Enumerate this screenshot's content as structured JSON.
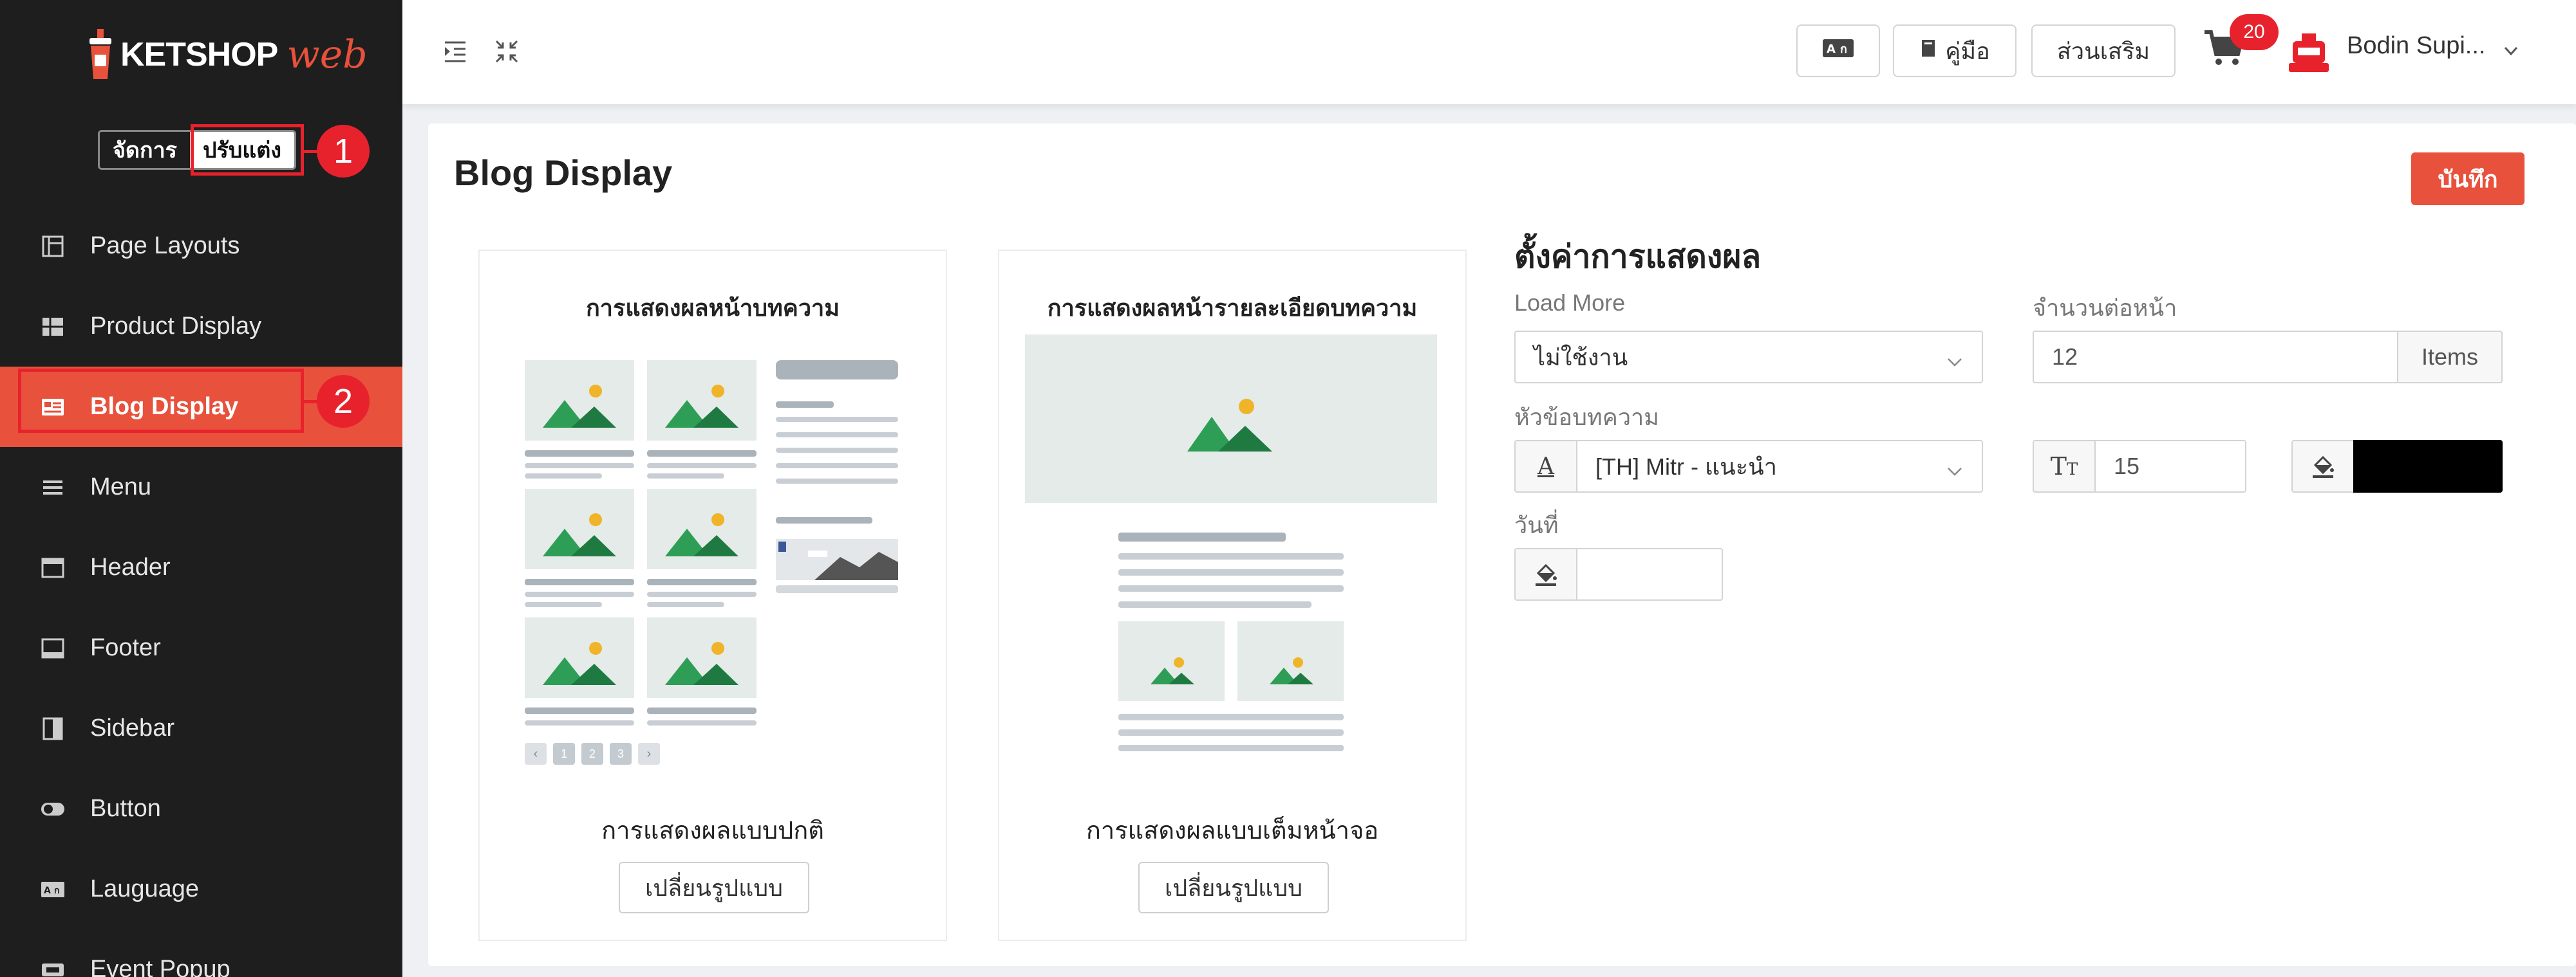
{
  "brand": {
    "name": "KETSHOP",
    "suffix": "web"
  },
  "mode_switch": {
    "manage_label": "จัดการ",
    "customize_label": "ปรับแต่ง"
  },
  "markers": [
    "1",
    "2"
  ],
  "sidebar": {
    "items": [
      {
        "label": "Page Layouts",
        "icon": "layout-icon"
      },
      {
        "label": "Product Display",
        "icon": "grid-icon"
      },
      {
        "label": "Blog Display",
        "icon": "blog-icon",
        "active": true
      },
      {
        "label": "Menu",
        "icon": "menu-icon"
      },
      {
        "label": "Header",
        "icon": "header-icon"
      },
      {
        "label": "Footer",
        "icon": "footer-icon"
      },
      {
        "label": "Sidebar",
        "icon": "sidebar-icon"
      },
      {
        "label": "Button",
        "icon": "toggle-icon"
      },
      {
        "label": "Lauguage",
        "icon": "language-icon"
      },
      {
        "label": "Event Popup",
        "icon": "ticket-icon"
      }
    ]
  },
  "topbar": {
    "manual_label": "คู่มือ",
    "addons_label": "ส่วนเสริม",
    "cart_count": "20",
    "username": "Bodin Supi..."
  },
  "page": {
    "title": "Blog Display",
    "save_label": "บันทึก"
  },
  "cards": [
    {
      "title": "การแสดงผลหน้าบทความ",
      "caption": "การแสดงผลแบบปกติ",
      "button": "เปลี่ยนรูปแบบ"
    },
    {
      "title": "การแสดงผลหน้ารายละเอียดบทความ",
      "caption": "การแสดงผลแบบเต็มหน้าจอ",
      "button": "เปลี่ยนรูปแบบ"
    }
  ],
  "pagination": [
    "1",
    "2",
    "3"
  ],
  "settings": {
    "title": "ตั้งค่าการแสดงผล",
    "load_more": {
      "label": "Load More",
      "value": "ไม่ใช้งาน"
    },
    "per_page": {
      "label": "จำนวนต่อหน้า",
      "value": "12",
      "unit": "Items"
    },
    "heading": {
      "label": "หัวข้อบทความ",
      "font": "[TH] Mitr - แนะนำ",
      "size": "15",
      "color": "#000000"
    },
    "date": {
      "label": "วันที่"
    }
  },
  "colors": {
    "accent": "#e8513b",
    "marker": "#e8222c",
    "sidebar_bg": "#1e1e1e"
  }
}
